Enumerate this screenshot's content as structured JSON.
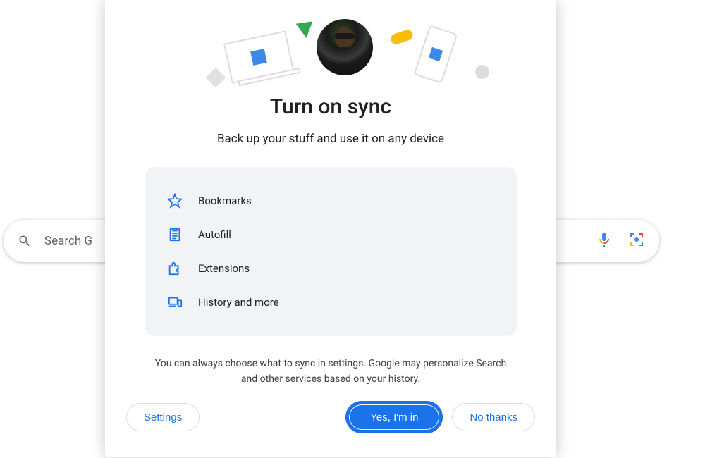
{
  "search": {
    "placeholder": "Search G"
  },
  "modal": {
    "title": "Turn on sync",
    "subtitle": "Back up your stuff and use it on any device",
    "features": {
      "bookmarks": "Bookmarks",
      "autofill": "Autofill",
      "extensions": "Extensions",
      "history": "History and more"
    },
    "disclaimer": "You can always choose what to sync in settings. Google may personalize Search and other services based on your history.",
    "buttons": {
      "settings": "Settings",
      "confirm": "Yes, I'm in",
      "decline": "No thanks"
    }
  }
}
